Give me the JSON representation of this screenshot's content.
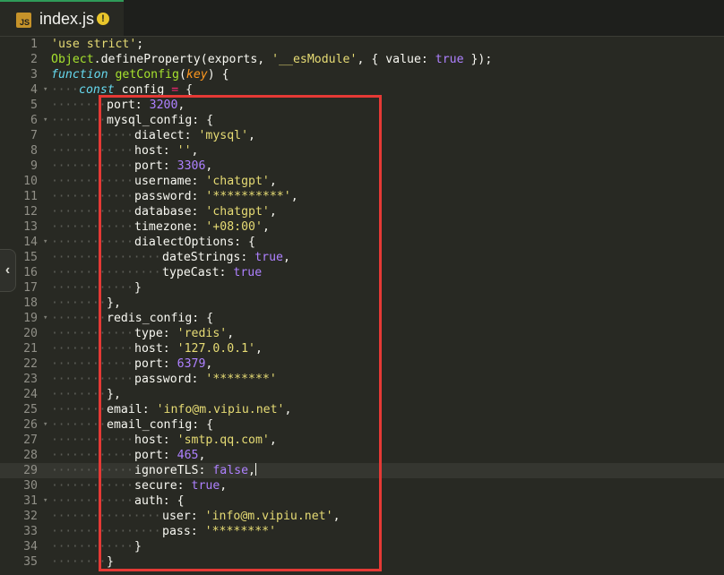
{
  "tab": {
    "badge": "JS",
    "title": "index.js",
    "warning_icon": "warning-icon"
  },
  "collapse_icon": "chevron-left-icon",
  "lines": [
    {
      "n": "1",
      "fold": "",
      "tokens": [
        [
          "cstr",
          "'use strict'"
        ],
        [
          "",
          "; "
        ]
      ]
    },
    {
      "n": "2",
      "fold": "",
      "tokens": [
        [
          "cfn",
          "Object"
        ],
        [
          "",
          "."
        ],
        [
          "",
          "defineProperty"
        ],
        [
          "",
          "(exports, "
        ],
        [
          "cstr",
          "'__esModule'"
        ],
        [
          "",
          ", { value: "
        ],
        [
          "cbool",
          "true"
        ],
        [
          "",
          " });"
        ]
      ]
    },
    {
      "n": "3",
      "fold": "",
      "tokens": [
        [
          "ckey",
          "function"
        ],
        [
          "",
          " "
        ],
        [
          "cfn",
          "getConfig"
        ],
        [
          "",
          "("
        ],
        [
          "cparam",
          "key"
        ],
        [
          "",
          ") {"
        ]
      ]
    },
    {
      "n": "4",
      "fold": "▾",
      "tokens": [
        [
          "ckey",
          "const"
        ],
        [
          "",
          " config "
        ],
        [
          "cop",
          "="
        ],
        [
          "",
          " {"
        ]
      ]
    },
    {
      "n": "5",
      "fold": "",
      "tokens": [
        [
          "",
          "port: "
        ],
        [
          "cnum",
          "3200"
        ],
        [
          "",
          ","
        ]
      ]
    },
    {
      "n": "6",
      "fold": "▾",
      "tokens": [
        [
          "",
          "mysql_config: {"
        ]
      ]
    },
    {
      "n": "7",
      "fold": "",
      "tokens": [
        [
          "",
          "dialect: "
        ],
        [
          "cstr",
          "'mysql'"
        ],
        [
          "",
          ","
        ]
      ]
    },
    {
      "n": "8",
      "fold": "",
      "tokens": [
        [
          "",
          "host: "
        ],
        [
          "cstr",
          "''"
        ],
        [
          "",
          ","
        ]
      ]
    },
    {
      "n": "9",
      "fold": "",
      "tokens": [
        [
          "",
          "port: "
        ],
        [
          "cnum",
          "3306"
        ],
        [
          "",
          ","
        ]
      ]
    },
    {
      "n": "10",
      "fold": "",
      "tokens": [
        [
          "",
          "username: "
        ],
        [
          "cstr",
          "'chatgpt'"
        ],
        [
          "",
          ","
        ]
      ]
    },
    {
      "n": "11",
      "fold": "",
      "tokens": [
        [
          "",
          "password: "
        ],
        [
          "cstr",
          "'**********'"
        ],
        [
          "",
          ","
        ]
      ]
    },
    {
      "n": "12",
      "fold": "",
      "tokens": [
        [
          "",
          "database: "
        ],
        [
          "cstr",
          "'chatgpt'"
        ],
        [
          "",
          ","
        ]
      ]
    },
    {
      "n": "13",
      "fold": "",
      "tokens": [
        [
          "",
          "timezone: "
        ],
        [
          "cstr",
          "'+08:00'"
        ],
        [
          "",
          ","
        ]
      ]
    },
    {
      "n": "14",
      "fold": "▾",
      "tokens": [
        [
          "",
          "dialectOptions: {"
        ]
      ]
    },
    {
      "n": "15",
      "fold": "",
      "tokens": [
        [
          "",
          "dateStrings: "
        ],
        [
          "cbool",
          "true"
        ],
        [
          "",
          ","
        ]
      ]
    },
    {
      "n": "16",
      "fold": "",
      "tokens": [
        [
          "",
          "typeCast: "
        ],
        [
          "cbool",
          "true"
        ]
      ]
    },
    {
      "n": "17",
      "fold": "",
      "tokens": [
        [
          "",
          "}"
        ]
      ]
    },
    {
      "n": "18",
      "fold": "",
      "tokens": [
        [
          "",
          "},"
        ]
      ]
    },
    {
      "n": "19",
      "fold": "▾",
      "tokens": [
        [
          "",
          "redis_config: {"
        ]
      ]
    },
    {
      "n": "20",
      "fold": "",
      "tokens": [
        [
          "",
          "type: "
        ],
        [
          "cstr",
          "'redis'"
        ],
        [
          "",
          ","
        ]
      ]
    },
    {
      "n": "21",
      "fold": "",
      "tokens": [
        [
          "",
          "host: "
        ],
        [
          "cstr",
          "'127.0.0.1'"
        ],
        [
          "",
          ","
        ]
      ]
    },
    {
      "n": "22",
      "fold": "",
      "tokens": [
        [
          "",
          "port: "
        ],
        [
          "cnum",
          "6379"
        ],
        [
          "",
          ","
        ]
      ]
    },
    {
      "n": "23",
      "fold": "",
      "tokens": [
        [
          "",
          "password: "
        ],
        [
          "cstr",
          "'********'"
        ]
      ]
    },
    {
      "n": "24",
      "fold": "",
      "tokens": [
        [
          "",
          "},"
        ]
      ]
    },
    {
      "n": "25",
      "fold": "",
      "tokens": [
        [
          "",
          "email: "
        ],
        [
          "cstr",
          "'info@m.vipiu.net'"
        ],
        [
          "",
          ","
        ]
      ]
    },
    {
      "n": "26",
      "fold": "▾",
      "tokens": [
        [
          "",
          "email_config: {"
        ]
      ]
    },
    {
      "n": "27",
      "fold": "",
      "tokens": [
        [
          "",
          "host: "
        ],
        [
          "cstr",
          "'smtp.qq.com'"
        ],
        [
          "",
          ","
        ]
      ]
    },
    {
      "n": "28",
      "fold": "",
      "tokens": [
        [
          "",
          "port: "
        ],
        [
          "cnum",
          "465"
        ],
        [
          "",
          ","
        ]
      ]
    },
    {
      "n": "29",
      "fold": "",
      "tokens": [
        [
          "",
          "ignoreTLS: "
        ],
        [
          "cbool",
          "false"
        ],
        [
          "",
          ","
        ]
      ]
    },
    {
      "n": "30",
      "fold": "",
      "tokens": [
        [
          "",
          "secure: "
        ],
        [
          "cbool",
          "true"
        ],
        [
          "",
          ","
        ]
      ]
    },
    {
      "n": "31",
      "fold": "▾",
      "tokens": [
        [
          "",
          "auth: {"
        ]
      ]
    },
    {
      "n": "32",
      "fold": "",
      "tokens": [
        [
          "",
          "user: "
        ],
        [
          "cstr",
          "'info@m.vipiu.net'"
        ],
        [
          "",
          ","
        ]
      ]
    },
    {
      "n": "33",
      "fold": "",
      "tokens": [
        [
          "",
          "pass: "
        ],
        [
          "cstr",
          "'********'"
        ]
      ]
    },
    {
      "n": "34",
      "fold": "",
      "tokens": [
        [
          "",
          "}"
        ]
      ]
    },
    {
      "n": "35",
      "fold": "",
      "tokens": [
        [
          "",
          "}"
        ]
      ]
    }
  ],
  "colors": {
    "background": "#282923",
    "highlight_border": "#e53935",
    "tab_accent": "#2f9b59"
  }
}
